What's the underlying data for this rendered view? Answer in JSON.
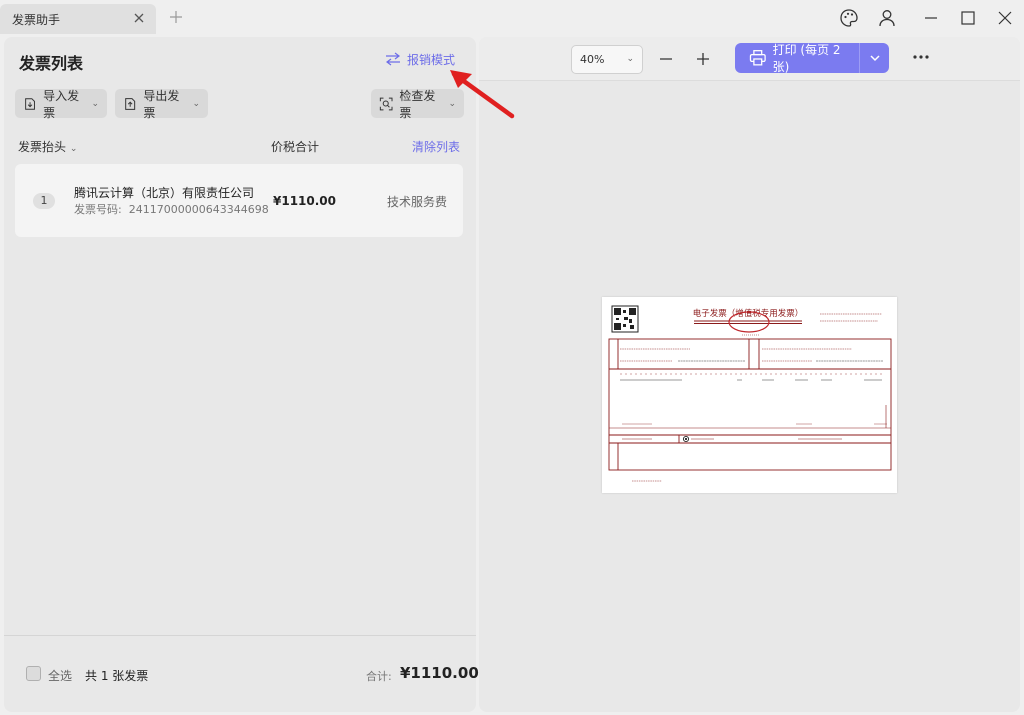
{
  "window": {
    "tab_title": "发票助手"
  },
  "left_panel": {
    "title": "发票列表",
    "mode_button": "报销模式",
    "toolbar": {
      "import_label": "导入发票",
      "export_label": "导出发票",
      "check_label": "检查发票"
    },
    "columns": {
      "header": "发票抬头",
      "amount": "价税合计",
      "clear": "清除列表"
    },
    "invoices": [
      {
        "index": "1",
        "company": "腾讯云计算（北京）有限责任公司",
        "code_label": "发票号码:",
        "code_value": "24117000000643344698",
        "amount": "¥1110.00",
        "category": "技术服务费"
      }
    ],
    "footer": {
      "select_all": "全选",
      "count_text": "共 1 张发票",
      "sum_label": "合计:",
      "sum_value": "¥1110.00"
    }
  },
  "right_panel": {
    "zoom": "40%",
    "zoom_out_icon": "minus-icon",
    "zoom_in_icon": "plus-icon",
    "print_label": "打印 (每页 2 张)",
    "more_icon": "ellipsis-icon"
  },
  "invoice_preview": {
    "title": "电子发票（增值税专用发票）",
    "buyer_name": "名称: 九江市某中学教育有限公司",
    "buyer_tax_id": "91360426MA7L3BY446",
    "seller_name": "名称: 腾讯云计算（北京）有限责任公司",
    "seller_tax_id": "91110108563654968​2",
    "item_line": "*信息技术服务*云服务费",
    "total_small": "¥1110.00",
    "drawer": "开票人: 李某某"
  },
  "colors": {
    "accent": "#7b7bf0",
    "link": "#6d6de8",
    "annotation_red": "#e02020",
    "invoice_red": "#8b1a1a"
  }
}
